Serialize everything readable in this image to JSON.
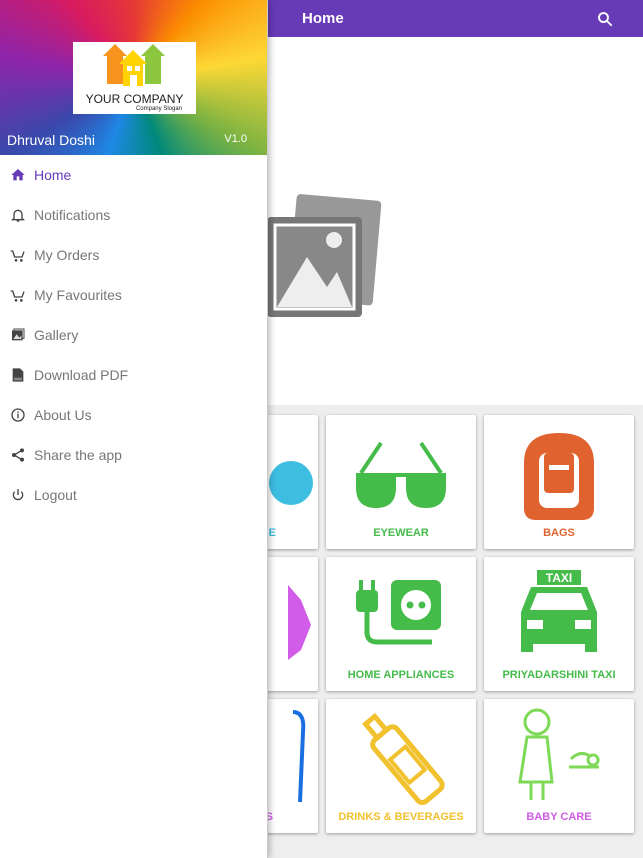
{
  "header": {
    "title": "Home",
    "search_icon": "search-icon"
  },
  "banner": {
    "slides": 3,
    "active_slide": 3
  },
  "drawer": {
    "logo": {
      "company": "YOUR COMPANY",
      "slogan": "Company Slogan"
    },
    "user_name": "Dhruval Doshi",
    "version": "V1.0",
    "items": [
      {
        "label": "Home",
        "icon": "home-icon",
        "active": true
      },
      {
        "label": "Notifications",
        "icon": "bell-icon"
      },
      {
        "label": "My Orders",
        "icon": "cart-icon"
      },
      {
        "label": "My Favourites",
        "icon": "cart-icon"
      },
      {
        "label": "Gallery",
        "icon": "gallery-icon"
      },
      {
        "label": "Download PDF",
        "icon": "pdf-icon"
      },
      {
        "label": "About Us",
        "icon": "info-icon"
      },
      {
        "label": "Share the app",
        "icon": "share-icon"
      },
      {
        "label": "Logout",
        "icon": "power-icon"
      }
    ]
  },
  "categories": [
    {
      "label": "E",
      "color": "#3dbde0"
    },
    {
      "label": "EYEWEAR",
      "color": "#45bb4a"
    },
    {
      "label": "BAGS",
      "color": "#e0632f"
    },
    {
      "label": "",
      "color": "#d15ce8"
    },
    {
      "label": "HOME APPLIANCES",
      "color": "#45bb4a"
    },
    {
      "label": "PRIYADARSHINI TAXI",
      "color": "#45bb4a"
    },
    {
      "label": "S",
      "color": "#1a6fe0"
    },
    {
      "label": "DRINKS & BEVERAGES",
      "color": "#f2c12e"
    },
    {
      "label": "BABY CARE",
      "color": "#d15ce8"
    }
  ],
  "colors": {
    "primary": "#673ab7",
    "taxi_text": "TAXI"
  }
}
